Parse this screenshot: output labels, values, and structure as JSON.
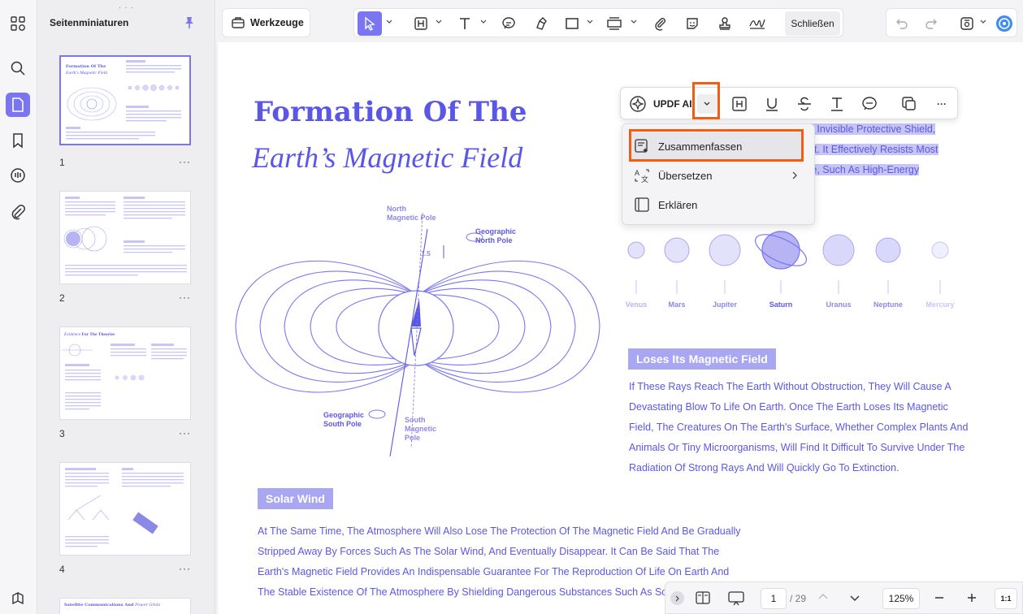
{
  "sidebar": {
    "title": "Seitenminiaturen"
  },
  "thumbnails": [
    {
      "num": "1",
      "title_a": "Formation Of The",
      "title_b": "Earth's Magnetic Field"
    },
    {
      "num": "2"
    },
    {
      "num": "3",
      "title_a": "Evidence",
      "title_b": "For The Theories"
    },
    {
      "num": "4"
    },
    {
      "title_a": "Satellite Communications And",
      "title_b": "Power Grids"
    }
  ],
  "thumb_menu": "···",
  "toolbar": {
    "werkzeuge": "Werkzeuge",
    "close": "Schließen"
  },
  "document": {
    "title_line1": "Formation Of The",
    "title_line2": "Earth’s Magnetic Field",
    "selected_lines": [
      "nd Invisible Protective Shield,",
      "ent. It Effectively Resists Most",
      "rse, Such As High-Energy"
    ],
    "diagram": {
      "north_magnetic": [
        "North",
        "Magnetic Pole"
      ],
      "geo_north": [
        "Geographic",
        "North Pole"
      ],
      "geo_south": [
        "Geographic",
        "South Pole"
      ],
      "south_magnetic": [
        "South",
        "Magnetic",
        "Pole"
      ],
      "angle": "1.5"
    },
    "planets": [
      "Venus",
      "Mars",
      "Jupiter",
      "Saturn",
      "Uranus",
      "Neptune",
      "Mercury"
    ],
    "section1": {
      "tag": "Loses Its Magnetic Field",
      "lines": [
        "If These Rays Reach The Earth Without Obstruction, They Will Cause A",
        "Devastating Blow To Life On Earth. Once The Earth Loses Its Magnetic",
        "Field, The Creatures On The Earth's Surface, Whether Complex Plants And",
        "Animals Or Tiny Microorganisms, Will Find It Difficult To Survive Under The",
        "Radiation Of Strong Rays And Will Quickly Go To Extinction."
      ]
    },
    "section2": {
      "tag": "Solar Wind",
      "lines": [
        "At The Same Time, The Atmosphere Will Also Lose The Protection Of The Magnetic Field And Be Gradually",
        "Stripped Away By Forces Such As The Solar Wind, And Eventually Disappear. It Can Be Said That The",
        "Earth's Magnetic Field Provides An Indispensable Guarantee For The Reproduction Of Life On Earth And",
        "The Stable Existence Of The Atmosphere By Shielding Dangerous Substances Such As Solar Pa"
      ]
    }
  },
  "floatbar": {
    "ai_label": "UPDF AI",
    "more": "···"
  },
  "ai_menu": {
    "items": [
      "Zusammenfassen",
      "Übersetzen",
      "Erklären"
    ]
  },
  "bottombar": {
    "page": "1",
    "total": "/ 29",
    "zoom": "125%",
    "fit": "1:1"
  },
  "colors": {
    "accent": "#7a76f2",
    "doc_text": "#5b57e6",
    "highlight": "#f25d12"
  }
}
